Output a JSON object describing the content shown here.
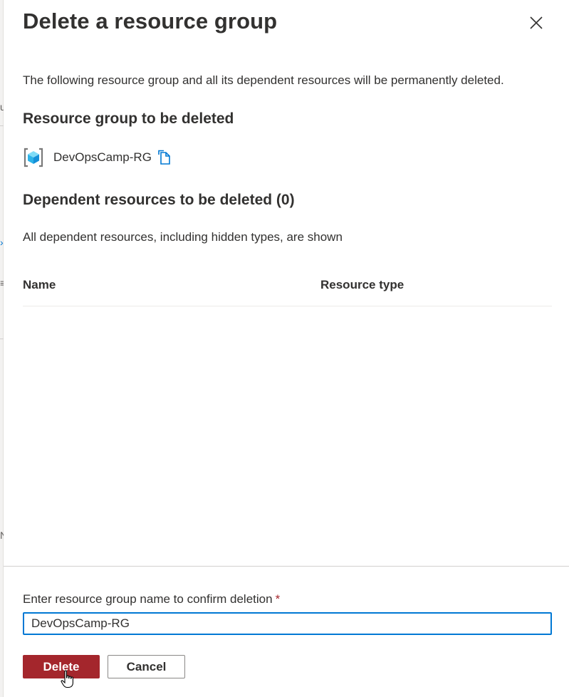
{
  "dialog": {
    "title": "Delete a resource group",
    "intro": "The following resource group and all its dependent resources will be permanently deleted."
  },
  "resource_group": {
    "heading": "Resource group to be deleted",
    "name": "DevOpsCamp-RG",
    "icon": "resource-group-icon"
  },
  "dependents": {
    "heading": "Dependent resources to be deleted (0)",
    "note": "All dependent resources, including hidden types, are shown",
    "columns": [
      "Name",
      "Resource type"
    ],
    "rows": []
  },
  "confirm": {
    "label": "Enter resource group name to confirm deletion",
    "required_mark": "*",
    "value": "DevOpsCamp-RG"
  },
  "buttons": {
    "delete": "Delete",
    "cancel": "Cancel"
  },
  "background_fragments": {
    "items": [
      "u",
      "›",
      "≡",
      "N"
    ]
  },
  "colors": {
    "delete_button": "#a4262c",
    "input_focus_border": "#0078d4",
    "required_star": "#a4262c",
    "icon_blue": "#0078d4"
  }
}
